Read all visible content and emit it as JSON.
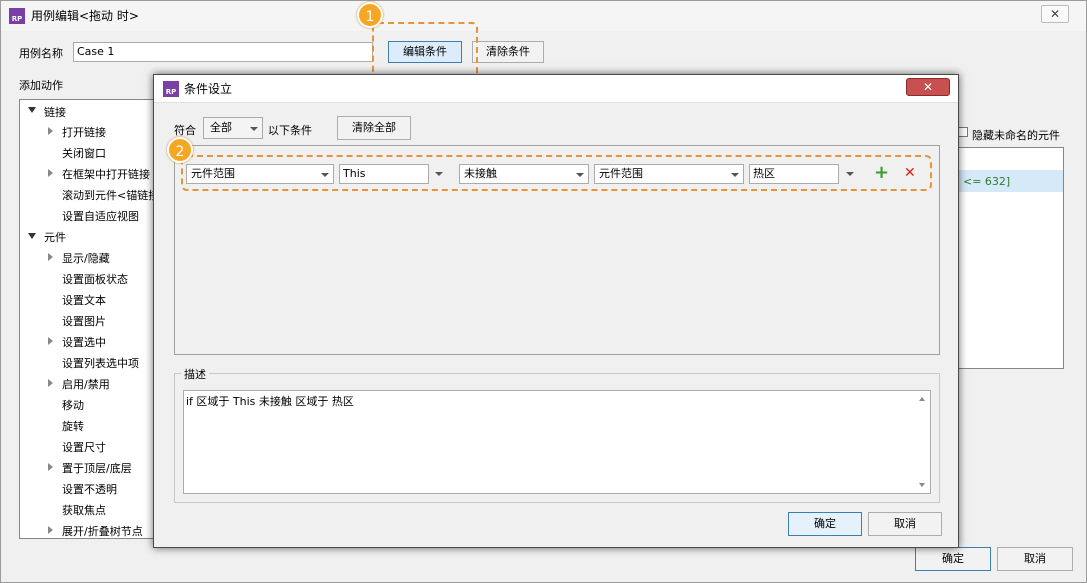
{
  "outer": {
    "title": "用例编辑<拖动 时>",
    "close_glyph": "✕",
    "case_name_label": "用例名称",
    "case_name_value": "Case 1",
    "edit_condition_label": "编辑条件",
    "clear_condition_label": "清除条件",
    "add_action_label": "添加动作",
    "hide_unnamed_label": "隐藏未命名的元件",
    "condition_snippet": "<= 632]",
    "ok_label": "确定",
    "cancel_label": "取消"
  },
  "tree": {
    "groups": [
      {
        "label": "链接",
        "items": [
          "打开链接",
          "关闭窗口",
          "在框架中打开链接",
          "滚动到元件<锚链接",
          "设置自适应视图"
        ]
      },
      {
        "label": "元件",
        "items": [
          "显示/隐藏",
          "设置面板状态",
          "设置文本",
          "设置图片",
          "设置选中",
          "设置列表选中项",
          "启用/禁用",
          "移动",
          "旋转",
          "设置尺寸",
          "置于顶层/底层",
          "设置不透明",
          "获取焦点",
          "展开/折叠树节点"
        ]
      }
    ]
  },
  "badges": {
    "one": "1",
    "two": "2"
  },
  "dialog": {
    "title": "条件设立",
    "close_glyph": "✕",
    "match_label": "符合",
    "match_value": "全部",
    "following_label": "以下条件",
    "clear_all_label": "清除全部",
    "condition": {
      "field1": "元件范围",
      "field2": "This",
      "operator": "未接触",
      "field3": "元件范围",
      "field4": "热区"
    },
    "add_glyph": "+",
    "delete_glyph": "✕",
    "description_label": "描述",
    "description_text": "if 区域于 This 未接触 区域于 热区",
    "ok_label": "确定",
    "cancel_label": "取消"
  },
  "colors": {
    "accent_blue": "#3c7fb1",
    "badge_orange": "#f5a623",
    "dash_orange": "#e4943a",
    "add_green": "#3a9a2a",
    "delete_red": "#d9261c",
    "rp_purple": "#7a3fa4"
  }
}
